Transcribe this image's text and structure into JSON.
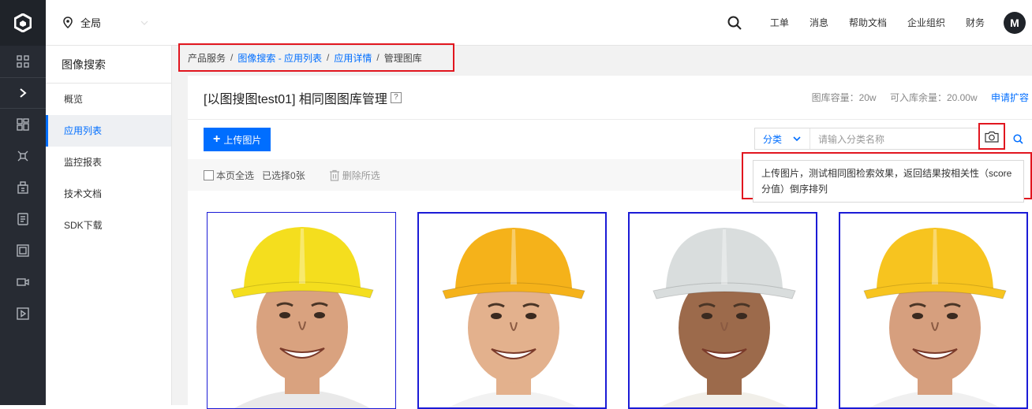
{
  "topbar": {
    "region": "全局",
    "nav": [
      "工单",
      "消息",
      "帮助文档",
      "企业组织",
      "财务"
    ],
    "avatar": "M"
  },
  "sidebar": {
    "title": "图像搜索",
    "items": [
      {
        "label": "概览",
        "active": false
      },
      {
        "label": "应用列表",
        "active": true
      },
      {
        "label": "监控报表",
        "active": false
      },
      {
        "label": "技术文档",
        "active": false
      },
      {
        "label": "SDK下载",
        "active": false
      }
    ]
  },
  "breadcrumb": {
    "root": "产品服务",
    "app_search": "图像搜索 - 应用列表",
    "app_detail": "应用详情",
    "current": "管理图库",
    "sep": "/"
  },
  "page": {
    "title": "[以图搜图test01] 相同图图库管理",
    "help": "?",
    "capacity": "图库容量：20w",
    "remaining": "可入库余量：20.00w",
    "expand": "申请扩容"
  },
  "toolbar": {
    "upload_label": "上传图片",
    "category_label": "分类",
    "category_placeholder": "请输入分类名称"
  },
  "selection": {
    "select_page": "本页全选",
    "selected_count": "已选择0张",
    "delete_selected": "删除所选"
  },
  "tooltip": {
    "text": "上传图片，测试相同图检索效果，返回结果按相关性（score分值）倒序排列"
  },
  "gallery": {
    "items": [
      {
        "helmet": "#f4de1e",
        "skin": "#d9a27f",
        "shirt": "#e9e9e9"
      },
      {
        "helmet": "#f5b21a",
        "skin": "#e3b18d",
        "shirt": "#f2f2f2"
      },
      {
        "helmet": "#d9dddd",
        "skin": "#9c6a4b",
        "shirt": "#f1efe9"
      },
      {
        "helmet": "#f7c41f",
        "skin": "#d69f7e",
        "shirt": "#f0f0f0"
      }
    ]
  },
  "colors": {
    "accent": "#006eff",
    "highlight": "#e1161f",
    "card_border": "#1b1bd6"
  }
}
